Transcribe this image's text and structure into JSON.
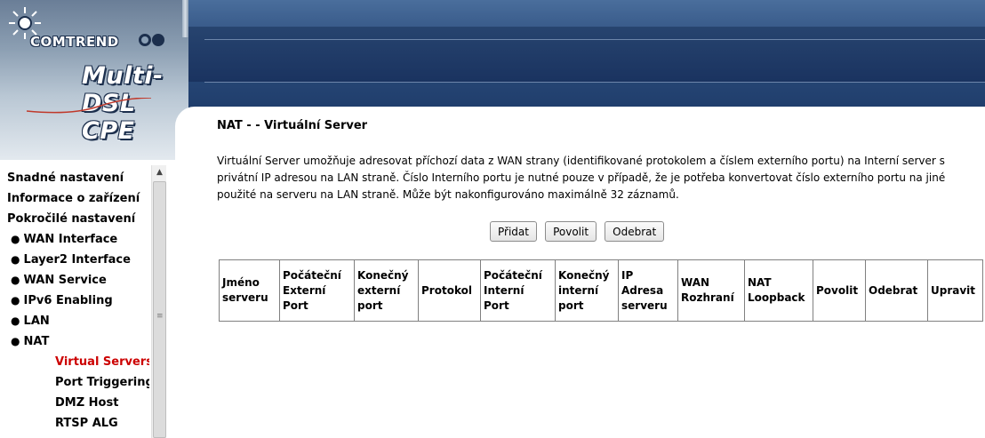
{
  "header": {
    "brand": "COMTREND",
    "product": "Multi-DSL CPE"
  },
  "sidebar": {
    "items": [
      {
        "label": "Snadné nastavení",
        "level": 0
      },
      {
        "label": "Informace o zařízení",
        "level": 0
      },
      {
        "label": "Pokročilé nastavení",
        "level": 0
      },
      {
        "label": "WAN Interface",
        "level": 1
      },
      {
        "label": "Layer2 Interface",
        "level": 1
      },
      {
        "label": "WAN Service",
        "level": 1
      },
      {
        "label": "IPv6 Enabling",
        "level": 1
      },
      {
        "label": "LAN",
        "level": 1
      },
      {
        "label": "NAT",
        "level": 1
      },
      {
        "label": "Virtual Servers",
        "level": 2,
        "active": true
      },
      {
        "label": "Port Triggering",
        "level": 2
      },
      {
        "label": "DMZ Host",
        "level": 2
      },
      {
        "label": "RTSP ALG",
        "level": 2
      }
    ],
    "bullet": "●"
  },
  "main": {
    "title": "NAT - - Virtuální Server",
    "description": "Virtuální Server umožňuje adresovat příchozí data z WAN strany (identifikované protokolem a číslem externího portu) na Interní server s privátní IP adresou na LAN straně. Číslo Interního portu je nutné pouze v případě, že je potřeba konvertovat číslo externího portu na jiné použité na serveru na LAN straně. Může být nakonfigurováno maximálně 32 záznamů.",
    "buttons": {
      "add": "Přidat",
      "enable": "Povolit",
      "remove": "Odebrat"
    },
    "table": {
      "headers": [
        "Jméno serveru",
        "Počáteční Externí Port",
        "Konečný externí port",
        "Protokol",
        "Počáteční Interní Port",
        "Konečný interní port",
        "IP Adresa serveru",
        "WAN Rozhraní",
        "NAT Loopback",
        "Povolit",
        "Odebrat",
        "Upravit"
      ]
    }
  },
  "colors": {
    "active_menu": "#cc0000",
    "banner_dark": "#1f3d6b"
  }
}
